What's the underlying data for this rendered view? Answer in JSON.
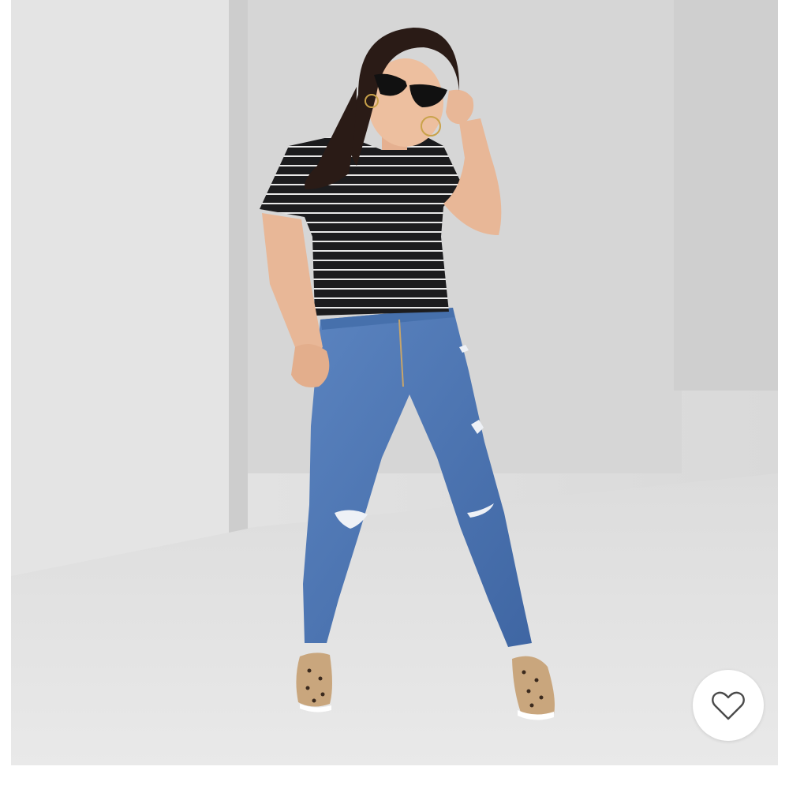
{
  "product_image": {
    "alt": "",
    "colors": {
      "backdrop": "#dcdcdc",
      "top": "#1c1c1e",
      "stripes": "#e9e9e9",
      "denim": "#4f78b5",
      "shoes": "#c9a67d"
    }
  },
  "favorite": {
    "icon": "heart-outline-icon",
    "icon_color": "#4a4a4a",
    "state": "not-favorited"
  }
}
